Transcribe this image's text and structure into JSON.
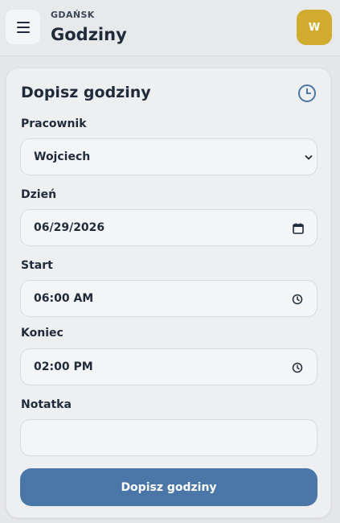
{
  "header": {
    "city": "GDAŃSK",
    "title": "Godziny",
    "avatar_initial": "W"
  },
  "form": {
    "title": "Dopisz godziny",
    "employee": {
      "label": "Pracownik",
      "value": "Wojciech"
    },
    "day": {
      "label": "Dzień",
      "value": "06/29/2026"
    },
    "start": {
      "label": "Start",
      "value": "06:00 AM"
    },
    "end": {
      "label": "Koniec",
      "value": "02:00 PM"
    },
    "note": {
      "label": "Notatka",
      "value": ""
    },
    "submit_label": "Dopisz godziny"
  },
  "icons": {
    "menu": "menu-icon",
    "clock": "clock-icon",
    "chevron": "chevron-down-icon",
    "calendar": "calendar-icon",
    "time": "time-icon"
  },
  "colors": {
    "accent": "#4a77a8",
    "avatar": "#d0ab2e",
    "text": "#1f2a3a"
  }
}
